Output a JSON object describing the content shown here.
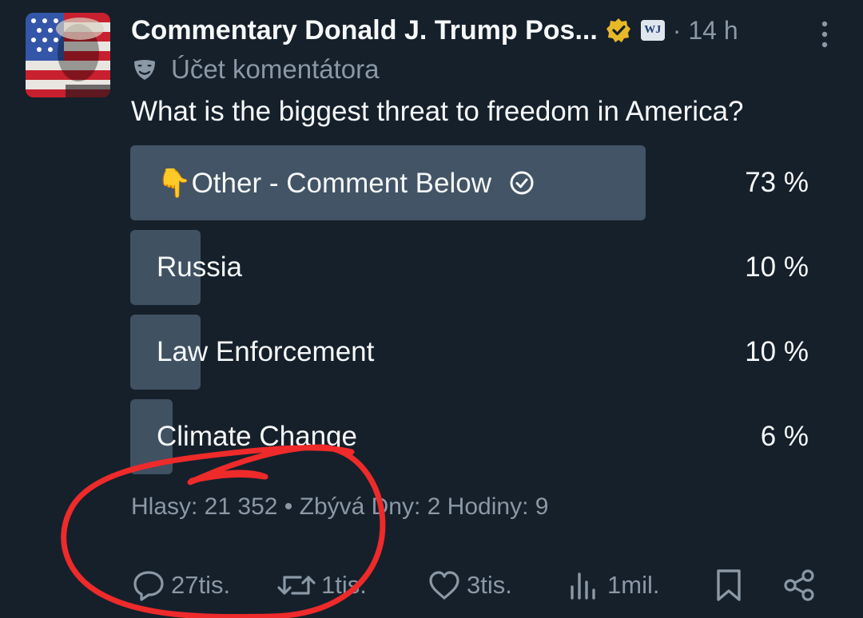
{
  "post": {
    "author_name": "Commentary Donald J. Trump Pos...",
    "affiliation_badge": "WJ",
    "time": "· 14 h",
    "account_label": "Účet komentátora",
    "question": "What is the biggest threat to freedom in America?"
  },
  "poll": {
    "options": [
      {
        "label": "👇Other - Comment Below",
        "percent_text": "73 %",
        "percent": 73,
        "selected": true
      },
      {
        "label": "Russia",
        "percent_text": "10 %",
        "percent": 10,
        "selected": false
      },
      {
        "label": "Law Enforcement",
        "percent_text": "10 %",
        "percent": 10,
        "selected": false
      },
      {
        "label": "Climate Change",
        "percent_text": "6 %",
        "percent": 6,
        "selected": false
      }
    ],
    "footer": "Hlasy: 21 352 • Zbývá Dny: 2 Hodiny: 9"
  },
  "actions": {
    "replies": "27tis.",
    "reposts": "1tis.",
    "likes": "3tis.",
    "views": "1mil."
  },
  "colors": {
    "background": "#15202b",
    "bar": "#425465",
    "muted_text": "#8b98a5",
    "annotation_red": "#ee2a2a",
    "verified_gold": "#e8b829"
  }
}
